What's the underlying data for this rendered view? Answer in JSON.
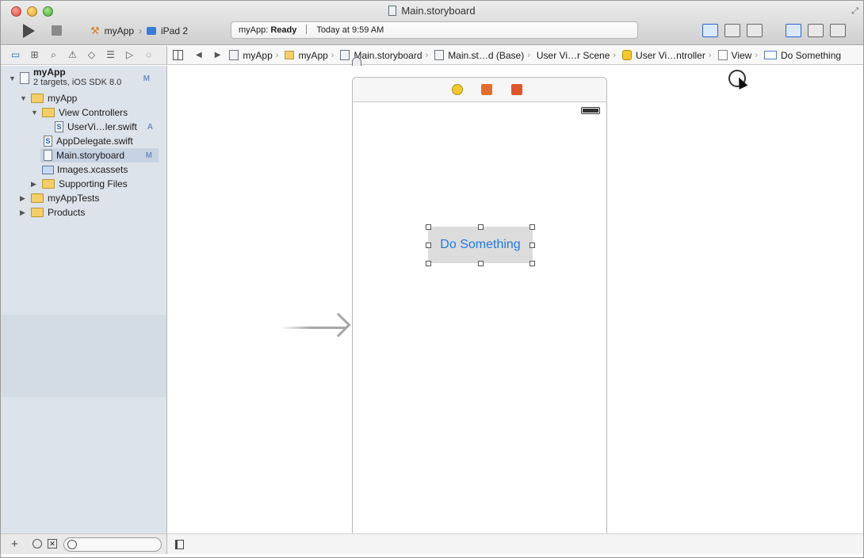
{
  "window": {
    "title": "Main.storyboard"
  },
  "toolbar": {
    "scheme_target": "myApp",
    "scheme_device": "iPad 2",
    "activity_app": "myApp:",
    "activity_status": "Ready",
    "activity_time": "Today at 9:59 AM"
  },
  "navigator": {
    "project_name": "myApp",
    "project_sub": "2 targets, iOS SDK 8.0",
    "project_badge": "M",
    "items": [
      {
        "label": "myApp"
      },
      {
        "label": "View Controllers"
      },
      {
        "label": "UserVi…ler.swift",
        "badge": "A"
      },
      {
        "label": "AppDelegate.swift"
      },
      {
        "label": "Main.storyboard",
        "badge": "M"
      },
      {
        "label": "Images.xcassets"
      },
      {
        "label": "Supporting Files"
      },
      {
        "label": "myAppTests"
      },
      {
        "label": "Products"
      }
    ]
  },
  "jumpbar": {
    "crumbs": [
      "myApp",
      "myApp",
      "Main.storyboard",
      "Main.st…d (Base)",
      "User Vi…r Scene",
      "User Vi…ntroller",
      "View",
      "Do Something"
    ]
  },
  "canvas": {
    "button_label": "Do Something"
  },
  "colors": {
    "accent": "#2a63c7",
    "button_text": "#1f7ae2",
    "navigator_bg": "#dde3ea"
  }
}
